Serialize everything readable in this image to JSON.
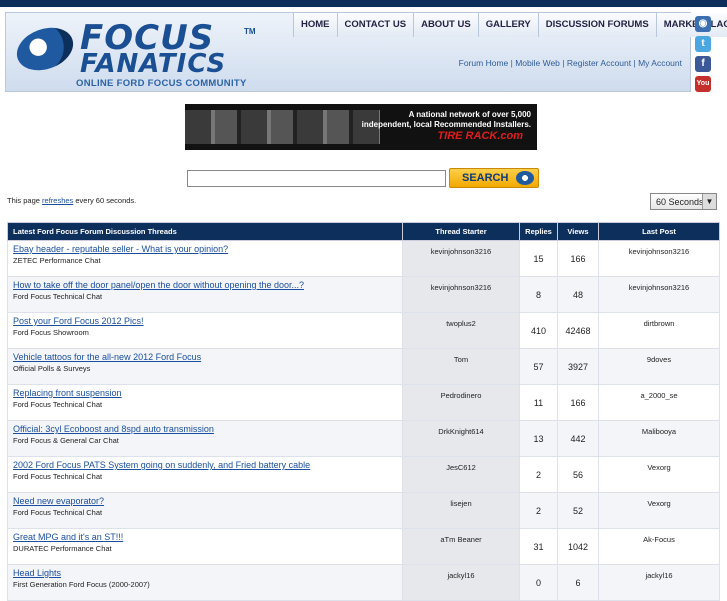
{
  "header": {
    "logo_word1": "FOCUS",
    "logo_word2": "FANATICS",
    "logo_tm": "TM",
    "tagline": "ONLINE FORD FOCUS COMMUNITY",
    "nav": [
      "HOME",
      "CONTACT US",
      "ABOUT US",
      "GALLERY",
      "DISCUSSION FORUMS",
      "MARKETPLACE"
    ],
    "subnav": [
      "Forum Home",
      "Mobile Web",
      "Register Account",
      "My Account"
    ],
    "subnav_sep": " | ",
    "social": [
      "rss-icon",
      "twitter-icon",
      "facebook-icon",
      "youtube-icon"
    ]
  },
  "banner": {
    "text": "A national network of over 5,000 independent, local Recommended Installers.",
    "brand": "TIRE RACK.com"
  },
  "search": {
    "placeholder": "",
    "button_label": "SEARCH"
  },
  "refresh": {
    "prefix": "This page ",
    "link": "refreshes",
    "suffix": " every 60 seconds.",
    "select_value": "60 Seconds"
  },
  "table": {
    "headers": [
      "Latest Ford Focus Forum Discussion Threads",
      "Thread Starter",
      "Replies",
      "Views",
      "Last Post"
    ],
    "rows": [
      {
        "title": "Ebay header - reputable seller - What is your opinion?",
        "forum": "ZETEC Performance Chat",
        "starter": "kevinjohnson3216",
        "replies": "15",
        "views": "166",
        "last": "kevinjohnson3216"
      },
      {
        "title": "How to take off the door panel/open the door without opening the door...?",
        "forum": "Ford Focus Technical Chat",
        "starter": "kevinjohnson3216",
        "replies": "8",
        "views": "48",
        "last": "kevinjohnson3216"
      },
      {
        "title": "Post your Ford Focus 2012 Pics!",
        "forum": "Ford Focus Showroom",
        "starter": "twoplus2",
        "replies": "410",
        "views": "42468",
        "last": "dirtbrown"
      },
      {
        "title": "Vehicle tattoos for the all-new 2012 Ford Focus",
        "forum": "Official Polls & Surveys",
        "starter": "Tom",
        "replies": "57",
        "views": "3927",
        "last": "9doves"
      },
      {
        "title": "Replacing front suspension",
        "forum": "Ford Focus Technical Chat",
        "starter": "Pedrodinero",
        "replies": "11",
        "views": "166",
        "last": "a_2000_se"
      },
      {
        "title": "Official: 3cyl Ecoboost and 8spd auto transmission",
        "forum": "Ford Focus & General Car Chat",
        "starter": "DrkKnight614",
        "replies": "13",
        "views": "442",
        "last": "Malibooya"
      },
      {
        "title": "2002 Ford Focus PATS System going on suddenly, and Fried battery cable",
        "forum": "Ford Focus Technical Chat",
        "starter": "JesC612",
        "replies": "2",
        "views": "56",
        "last": "Vexorg"
      },
      {
        "title": "Need new evaporator?",
        "forum": "Ford Focus Technical Chat",
        "starter": "lisejen",
        "replies": "2",
        "views": "52",
        "last": "Vexorg"
      },
      {
        "title": "Great MPG and it's an ST!!!",
        "forum": "DURATEC Performance Chat",
        "starter": "aTm Beaner",
        "replies": "31",
        "views": "1042",
        "last": "Ak-Focus"
      },
      {
        "title": "Head Lights",
        "forum": "First Generation Ford Focus (2000-2007)",
        "starter": "jackyl16",
        "replies": "0",
        "views": "6",
        "last": "jackyl16"
      }
    ]
  },
  "colors": {
    "header_bar": "#0d2f5c",
    "link": "#1a4fa0",
    "search_button": "#f2a800"
  }
}
